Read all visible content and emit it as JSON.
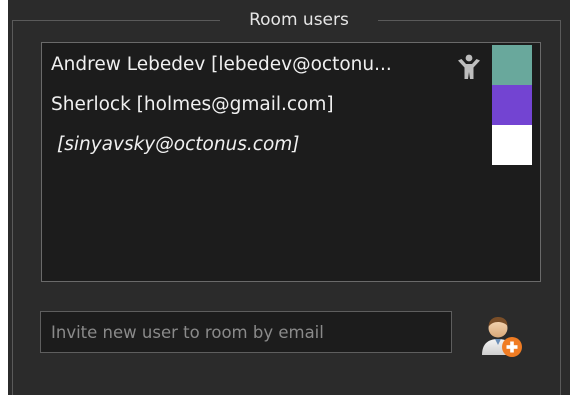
{
  "group": {
    "title": "Room users"
  },
  "users": [
    {
      "label": "Andrew Lebedev [lebedev@octonu...",
      "color": "#69a89c",
      "italic": false,
      "is_owner": true,
      "icon": "owner-person-icon"
    },
    {
      "label": "Sherlock [holmes@gmail.com]",
      "color": "#7344d2",
      "italic": false,
      "is_owner": false
    },
    {
      "label": "[sinyavsky@octonus.com]",
      "color": "#ffffff",
      "italic": true,
      "is_owner": false
    }
  ],
  "invite": {
    "placeholder": "Invite new user to room by email",
    "value": "",
    "button_icon": "add-user-icon"
  },
  "colors": {
    "panel_background": "#2b2b2b",
    "list_background": "#1c1c1c",
    "text": "#f0f0f0",
    "add_badge": "#f07c23"
  }
}
